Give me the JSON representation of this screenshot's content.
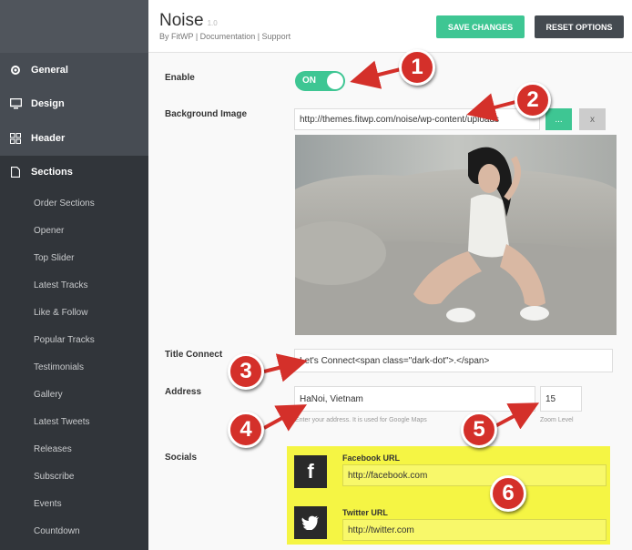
{
  "sidebar": {
    "main_items": [
      {
        "label": "General",
        "icon": "gear-icon"
      },
      {
        "label": "Design",
        "icon": "monitor-icon"
      },
      {
        "label": "Header",
        "icon": "grid-icon"
      },
      {
        "label": "Sections",
        "icon": "document-icon"
      }
    ],
    "sub_items": [
      "Order Sections",
      "Opener",
      "Top Slider",
      "Latest Tracks",
      "Like & Follow",
      "Popular Tracks",
      "Testimonials",
      "Gallery",
      "Latest Tweets",
      "Releases",
      "Subscribe",
      "Events",
      "Countdown"
    ]
  },
  "header": {
    "title": "Noise",
    "version": "1.0",
    "byline": "By FitWP | Documentation | Support",
    "save_label": "SAVE CHANGES",
    "reset_label": "RESET OPTIONS"
  },
  "form": {
    "enable_label": "Enable",
    "toggle_text": "ON",
    "bg_label": "Background Image",
    "bg_url": "http://themes.fitwp.com/noise/wp-content/uploads",
    "upload_btn": "...",
    "remove_btn": "x",
    "title_connect_label": "Title Connect",
    "title_connect_value": "Let's Connect<span class=\"dark-dot\">.</span>",
    "address_label": "Address",
    "address_value": "HaNoi, Vietnam",
    "address_hint": "Enter your address. It is used for Google Maps",
    "zoom_value": "15",
    "zoom_hint": "Zoom Level",
    "socials_label": "Socials",
    "facebook_label": "Facebook URL",
    "facebook_value": "http://facebook.com",
    "twitter_label": "Twitter URL",
    "twitter_value": "http://twitter.com"
  },
  "callouts": [
    "1",
    "2",
    "3",
    "4",
    "5",
    "6"
  ],
  "colors": {
    "accent": "#3ec693",
    "sidebar": "#474c53",
    "callout": "#d4302a",
    "highlight": "#f5f544"
  }
}
